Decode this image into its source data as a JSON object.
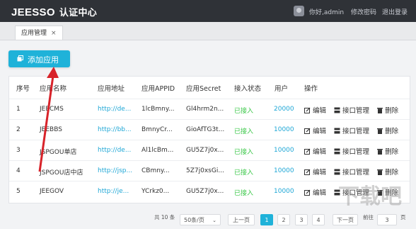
{
  "header": {
    "brand": "JEESSO",
    "brand_cn": "认证中心",
    "greeting": "你好,admin",
    "change_password": "修改密码",
    "logout": "退出登录"
  },
  "tabs": [
    {
      "label": "应用管理",
      "close": "×"
    }
  ],
  "toolbar": {
    "add_label": "添加应用"
  },
  "table": {
    "headers": [
      "序号",
      "应用名称",
      "应用地址",
      "应用APPID",
      "应用Secret",
      "接入状态",
      "用户",
      "操作"
    ],
    "rows": [
      {
        "no": "1",
        "name": "JEECMS",
        "url": "http://de...",
        "appid": "1lcBmny...",
        "secret": "Gl4hrm2n...",
        "status": "已接入",
        "users": "20000"
      },
      {
        "no": "2",
        "name": "JEEBBS",
        "url": "http://bb...",
        "appid": "BmnyCr...",
        "secret": "GioAfTG3t...",
        "status": "已接入",
        "users": "10000"
      },
      {
        "no": "3",
        "name": "JSPGOU单店",
        "url": "http://de...",
        "appid": "Al1lcBm...",
        "secret": "GU5Z7j0x...",
        "status": "已接入",
        "users": "10000"
      },
      {
        "no": "4",
        "name": "JSPGOU店中店",
        "url": "http://jsp...",
        "appid": "CBmny...",
        "secret": "5Z7j0xsGi...",
        "status": "已接入",
        "users": "10000"
      },
      {
        "no": "5",
        "name": "JEEGOV",
        "url": "http://je...",
        "appid": "YCrkz0...",
        "secret": "GU5Z7j0x...",
        "status": "已接入",
        "users": "10000"
      }
    ],
    "ops": {
      "edit": "编辑",
      "interface": "接口管理",
      "delete": "删除"
    }
  },
  "pagination": {
    "total": "共 10 条",
    "page_size": "50条/页",
    "prev": "上一页",
    "pages": [
      "1",
      "2",
      "3",
      "4"
    ],
    "next": "下一页",
    "goto": "前往",
    "goto_value": "3",
    "page_unit": "页"
  },
  "colors": {
    "accent": "#1fb2d9",
    "link": "#1fa7d6",
    "status": "#3cc84a",
    "header": "#2f3237"
  },
  "watermark": "下载吧"
}
